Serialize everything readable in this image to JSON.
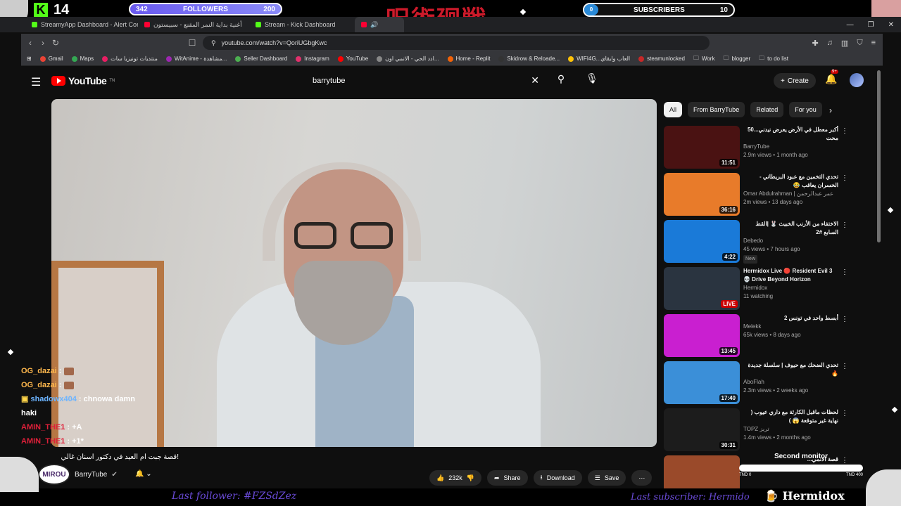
{
  "overlay": {
    "kick_count": "14",
    "followers": {
      "current": "342",
      "label": "FOLLOWERS",
      "goal": "200"
    },
    "subscribers": {
      "current": "0",
      "label": "SUBSCRIBERS",
      "goal": "10"
    },
    "logo_text": "呪術廻戦"
  },
  "browser": {
    "tabs": [
      {
        "label": "StreamyApp Dashboard - Alert Conf",
        "icon": "kick-icon"
      },
      {
        "label": "أغنية بداية النمر المقنع - سبيستون",
        "icon": "youtube-icon"
      },
      {
        "label": "Stream - Kick Dashboard",
        "icon": "kick-icon"
      },
      {
        "label": "",
        "icon": "youtube-icon"
      }
    ],
    "url": "youtube.com/watch?v=QoriUGbgKwc",
    "bookmarks": [
      "Gmail",
      "Maps",
      "منتديات تونيزيا سات",
      "WitAnime - مشاهدة...",
      "Seller Dashboard",
      "Instagram",
      "YouTube",
      "ادد الحي - الانمي اون...",
      "Home - Replit",
      "Skidrow & Reloade...",
      "WIFI4G...العاب وايقاي",
      "steamunlocked",
      "Work",
      "blogger",
      "to do list"
    ]
  },
  "youtube": {
    "logo": "YouTube",
    "logo_tm": "TN",
    "search_query": "barrytube",
    "create_label": "Create",
    "notif_count": "9+",
    "video_title": "!قصة جبت ام العيد في دكتور اسنان غالي",
    "channel": "BarryTube",
    "channel_avatar_text": "MIROU",
    "actions": {
      "likes": "232k",
      "share": "Share",
      "download": "Download",
      "save": "Save"
    },
    "chips": [
      "All",
      "From BarryTube",
      "Related",
      "For you"
    ],
    "related": [
      {
        "title": "أكبر معطل في الأرض يعرض نيدني...50 محت",
        "channel": "BarryTube",
        "stats": "2.9m views • 1 month ago",
        "duration": "11:51",
        "thumb_color": "#4a1212"
      },
      {
        "title": "تحدي التخمين مع عبود البريطاني - الخسران يعاقب 😂",
        "channel": "Omar Abdulrahman | عمر عبدالرحمن",
        "stats": "2m views • 13 days ago",
        "duration": "36:16",
        "thumb_color": "#e87b2a"
      },
      {
        "title": "الاختفاء من الأرنب الخبيث 🐰 |القط السابع #2",
        "channel": "Debedo",
        "stats": "45 views • 7 hours ago",
        "duration": "4:22",
        "badge": "New",
        "thumb_color": "#1a7ad8"
      },
      {
        "title": "Hermidox Live 🔴 Resident Evil 3 💀 Drive Beyond Horizon",
        "channel": "Hermidox",
        "stats": "11 watching",
        "duration": "LIVE",
        "thumb_color": "#2a3440"
      },
      {
        "title": "أبسط واحد في تونس 2",
        "channel": "Melekk",
        "stats": "65k views • 8 days ago",
        "duration": "13:45",
        "thumb_color": "#c91fd0"
      },
      {
        "title": "تحدي الضحك مع حيوف | سلسلة جديدة 🔥",
        "channel": "AboFlah",
        "stats": "2.3m views • 2 weeks ago",
        "duration": "17:40",
        "thumb_color": "#3b8fd8"
      },
      {
        "title": "لحظات ماقبل الكارثة مع داري عيوب ( نهاية غير متوقعة 😱 )",
        "channel": "TOPZ تربز",
        "stats": "1.4m views • 2 months ago",
        "duration": "30:31",
        "thumb_color": "#1c1c1c"
      },
      {
        "title": "قصة الانمي...",
        "channel": "",
        "stats": "",
        "duration": "",
        "thumb_color": "#9a4a2a"
      }
    ]
  },
  "chat": [
    {
      "user": "OG_dazai",
      "text": "",
      "emote": true,
      "color": "orange"
    },
    {
      "user": "OG_dazai",
      "text": "",
      "emote": true,
      "color": "orange"
    },
    {
      "user": "shadowx404",
      "text": "chnowa damn",
      "emote": false,
      "color": "blue"
    },
    {
      "user": "",
      "text": "haki",
      "emote": false,
      "color": "white"
    },
    {
      "user": "AMIN_THE1",
      "text": "+A",
      "emote": false,
      "color": "red"
    },
    {
      "user": "AMIN_THE1",
      "text": "+1*",
      "emote": false,
      "color": "red"
    }
  ],
  "second_monitor": {
    "label": "Second monitor",
    "start": "TND 0",
    "end": "TND 400"
  },
  "bottom": {
    "last_follower": "Last follower: #FZSdZez",
    "last_subscriber": "Last subscriber: Hermido",
    "brand": "Hermidox"
  }
}
